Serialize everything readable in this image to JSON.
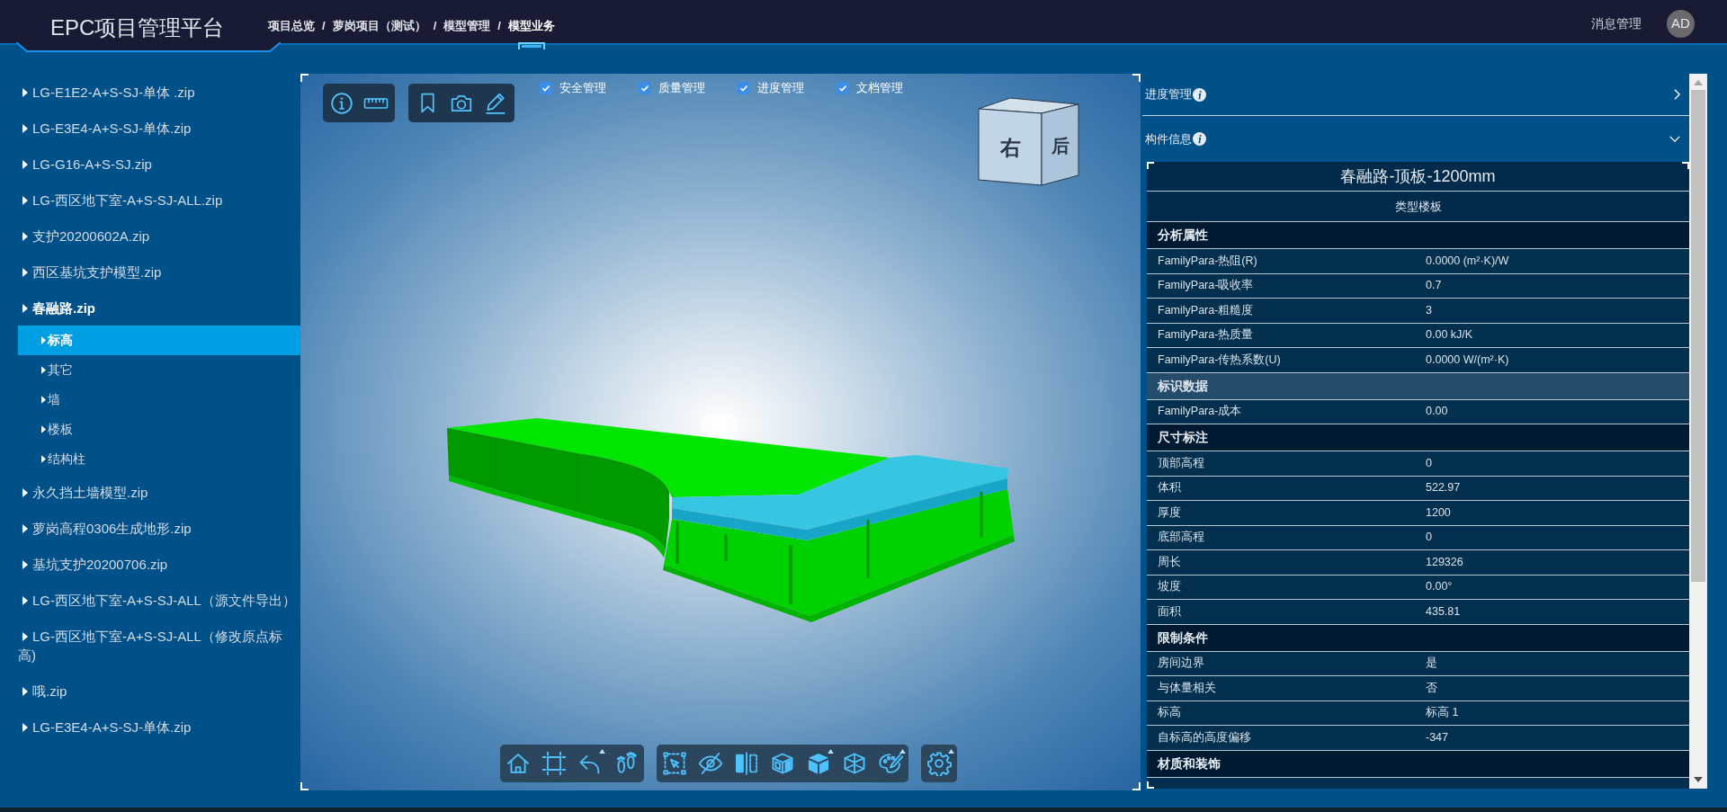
{
  "header": {
    "title": "EPC项目管理平台",
    "breadcrumbs": [
      {
        "label": "项目总览",
        "selected": false
      },
      {
        "separator": "/",
        "label": "萝岗项目（测试）",
        "selected": false
      },
      {
        "separator": "/",
        "label": "模型管理",
        "selected": false
      },
      {
        "separator": "/",
        "label": "模型业务",
        "selected": true
      }
    ],
    "messages_link": "消息管理",
    "avatar": "AD"
  },
  "sidebar": {
    "items": [
      {
        "label": "LG-E1E2-A+S-SJ-单体 .zip",
        "expanded": false
      },
      {
        "label": "LG-E3E4-A+S-SJ-单体.zip",
        "expanded": false
      },
      {
        "label": "LG-G16-A+S-SJ.zip",
        "expanded": false
      },
      {
        "label": "LG-西区地下室-A+S-SJ-ALL.zip",
        "expanded": false
      },
      {
        "label": "支护20200602A.zip",
        "expanded": false
      },
      {
        "label": "西区基坑支护模型.zip",
        "expanded": false
      },
      {
        "label": "春融路.zip",
        "expanded": true,
        "children": [
          {
            "label": "标高",
            "selected": true
          },
          {
            "label": "其它",
            "selected": false
          },
          {
            "label": "墙",
            "selected": false
          },
          {
            "label": "楼板",
            "selected": false
          },
          {
            "label": "结构柱",
            "selected": false
          }
        ]
      },
      {
        "label": "永久挡土墙模型.zip",
        "expanded": false
      },
      {
        "label": "萝岗高程0306生成地形.zip",
        "expanded": false
      },
      {
        "label": "基坑支护20200706.zip",
        "expanded": false
      },
      {
        "label": "LG-西区地下室-A+S-SJ-ALL（源文件导出）",
        "expanded": false
      },
      {
        "label": "LG-西区地下室-A+S-SJ-ALL（修改原点标高)",
        "expanded": false
      },
      {
        "label": "哦.zip",
        "expanded": false
      },
      {
        "label": "LG-E3E4-A+S-SJ-单体.zip",
        "expanded": false
      }
    ]
  },
  "viewer": {
    "layers": [
      {
        "label": "安全管理",
        "checked": true
      },
      {
        "label": "质量管理",
        "checked": true
      },
      {
        "label": "进度管理",
        "checked": true
      },
      {
        "label": "文档管理",
        "checked": true
      }
    ],
    "view_cube": {
      "faces": [
        "右",
        "后"
      ]
    },
    "bottom_toolbar": [
      [
        {
          "has_menu": false
        },
        {
          "has_menu": false
        },
        {
          "has_menu": true
        },
        {
          "has_menu": false
        }
      ],
      [
        {
          "has_menu": false
        },
        {
          "has_menu": false
        },
        {
          "has_menu": false
        },
        {
          "has_menu": false
        },
        {
          "has_menu": true
        },
        {
          "has_menu": false
        },
        {
          "has_menu": true
        }
      ],
      [
        {
          "has_menu": true
        }
      ]
    ]
  },
  "panels": [
    {
      "title": "进度管理",
      "expanded": false
    },
    {
      "title": "构件信息",
      "expanded": true,
      "properties": {
        "title": "春融路-顶板-1200mm",
        "subtitle": "类型楼板",
        "groups": [
          {
            "name": "分析属性",
            "hovered": false,
            "rows": [
              {
                "key": "FamilyPara-热阻(R)",
                "value": "0.0000 (m²·K)/W"
              },
              {
                "key": "FamilyPara-吸收率",
                "value": "0.7"
              },
              {
                "key": "FamilyPara-粗糙度",
                "value": "3"
              },
              {
                "key": "FamilyPara-热质量",
                "value": "0.00 kJ/K"
              },
              {
                "key": "FamilyPara-传热系数(U)",
                "value": "0.0000 W/(m²·K)"
              }
            ]
          },
          {
            "name": "标识数据",
            "hovered": true,
            "rows": [
              {
                "key": "FamilyPara-成本",
                "value": "0.00"
              }
            ]
          },
          {
            "name": "尺寸标注",
            "hovered": false,
            "rows": [
              {
                "key": "顶部高程",
                "value": "0"
              },
              {
                "key": "体积",
                "value": "522.97"
              },
              {
                "key": "厚度",
                "value": "1200"
              },
              {
                "key": "底部高程",
                "value": "0"
              },
              {
                "key": "周长",
                "value": "129326"
              },
              {
                "key": "坡度",
                "value": "0.00°"
              },
              {
                "key": "面积",
                "value": "435.81"
              }
            ]
          },
          {
            "name": "限制条件",
            "hovered": false,
            "rows": [
              {
                "key": "房间边界",
                "value": "是"
              },
              {
                "key": "与体量相关",
                "value": "否"
              },
              {
                "key": "标高",
                "value": "标高 1"
              },
              {
                "key": "自标高的高度偏移",
                "value": "-347"
              }
            ]
          },
          {
            "name": "材质和装饰",
            "hovered": false
          }
        ]
      }
    }
  ]
}
